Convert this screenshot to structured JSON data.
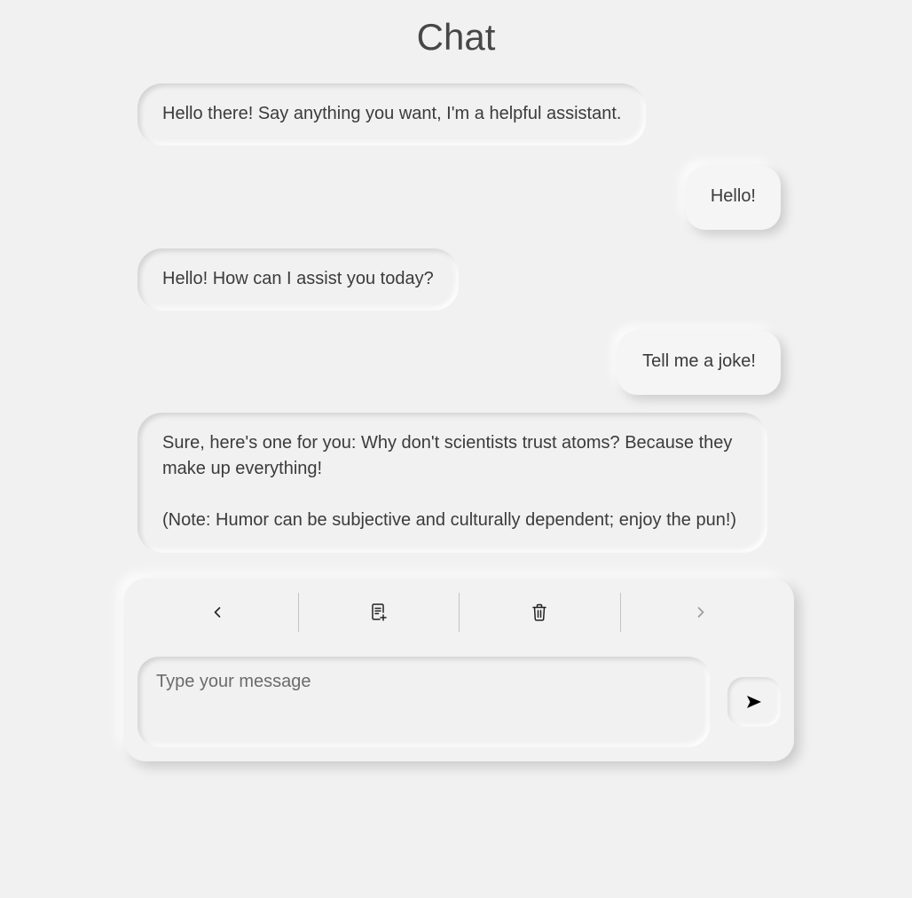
{
  "page": {
    "title": "Chat"
  },
  "messages": [
    {
      "role": "assistant",
      "text": "Hello there! Say anything you want, I'm a helpful assistant."
    },
    {
      "role": "user",
      "text": "Hello!"
    },
    {
      "role": "assistant",
      "text": "Hello! How can I assist you today?"
    },
    {
      "role": "user",
      "text": "Tell me a joke!"
    },
    {
      "role": "assistant",
      "text": "Sure, here's one for you: Why don't scientists trust atoms? Because they make up everything!\n\n(Note: Humor can be subjective and culturally dependent; enjoy the pun!)"
    }
  ],
  "toolbar": {
    "items": [
      {
        "icon": "chevron-left-icon",
        "enabled": true
      },
      {
        "icon": "new-note-icon",
        "enabled": true
      },
      {
        "icon": "trash-icon",
        "enabled": true
      },
      {
        "icon": "chevron-right-icon",
        "enabled": false
      }
    ]
  },
  "composer": {
    "placeholder": "Type your message",
    "value": "",
    "send_icon": "send-arrow-icon"
  },
  "colors": {
    "background": "#f1f1f1",
    "text": "#3b3b3b",
    "disabled_icon": "#9a9a9a"
  }
}
